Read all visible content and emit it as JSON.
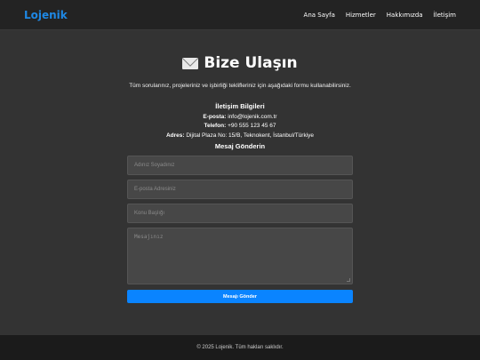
{
  "header": {
    "logo": "Lojenik",
    "nav": [
      "Ana Sayfa",
      "Hizmetler",
      "Hakkımızda",
      "İletişim"
    ]
  },
  "main": {
    "title": "Bize Ulaşın",
    "title_icon": "envelope-icon",
    "intro": "Tüm sorularınız, projeleriniz ve işbirliği teklifleriniz için aşağıdaki formu kullanabilirsiniz.",
    "contact": {
      "heading": "İletişim Bilgileri",
      "email_label": "E-posta:",
      "email": "info@lojenik.com.tr",
      "phone_label": "Telefon:",
      "phone": "+90 555 123 45 67",
      "address_label": "Adres:",
      "address": "Dijital Plaza No: 15/B, Teknokent, İstanbul/Türkiye"
    },
    "form": {
      "heading": "Mesaj Gönderin",
      "name_placeholder": "Adınız Soyadınız",
      "email_placeholder": "E-posta Adresiniz",
      "subject_placeholder": "Konu Başlığı",
      "message_placeholder": "Mesajınız",
      "submit_label": "Mesajı Gönder"
    }
  },
  "footer": {
    "text": "© 2025 Lojenik. Tüm hakları saklıdır."
  },
  "colors": {
    "accent": "#0a84ff",
    "logo": "#1e88e5",
    "background": "#333333",
    "header": "#232323"
  }
}
